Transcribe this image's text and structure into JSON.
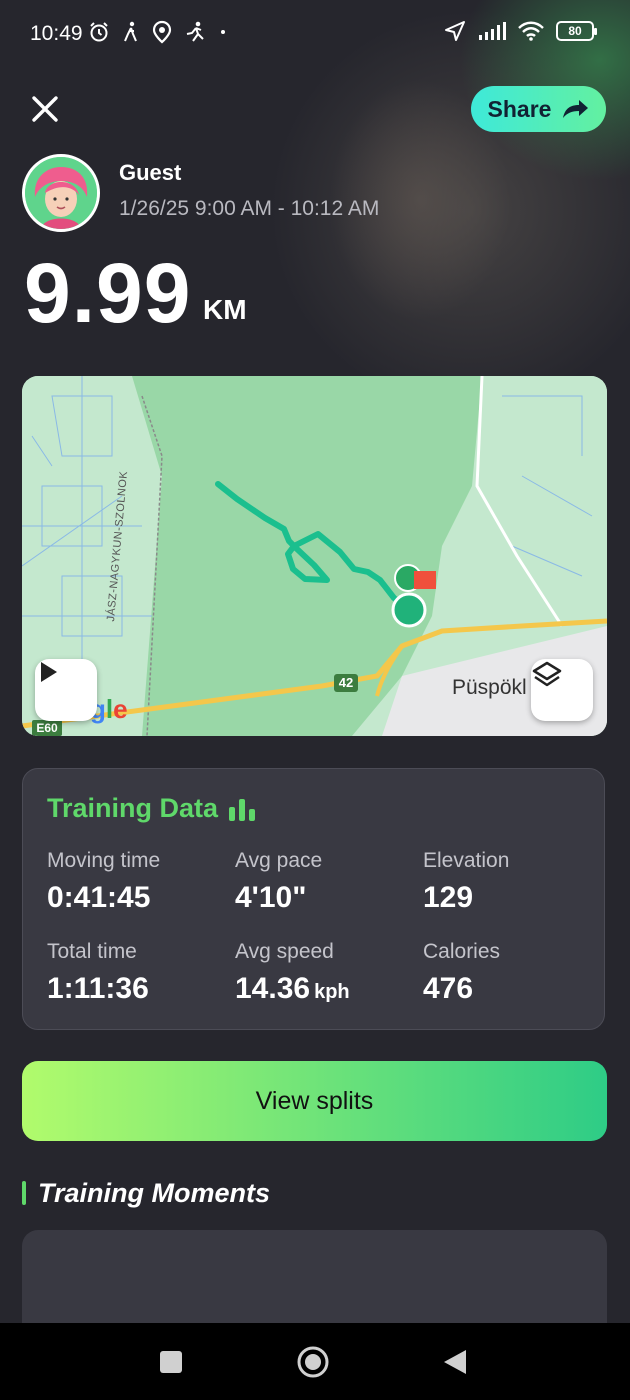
{
  "status_bar": {
    "time": "10:49",
    "battery": "80",
    "left_icons": [
      "alarm-icon",
      "walk-icon",
      "location-icon",
      "run-icon",
      "dot-icon"
    ],
    "right_icons": [
      "navigation-icon",
      "signal-icon",
      "wifi-icon",
      "battery-icon"
    ]
  },
  "header": {
    "close_icon": "close-icon",
    "share_label": "Share",
    "share_icon": "share-arrow-icon"
  },
  "user": {
    "name": "Guest",
    "date_range": "1/26/25 9:00 AM - 10:12 AM"
  },
  "distance": {
    "value": "9.99",
    "unit": "KM"
  },
  "map": {
    "town_label": "Püspökl",
    "road_number": "42",
    "euro_route": "E60",
    "road_name": "JÁSZ-NAGYKUN-SZOLNOK",
    "google_text": "Google",
    "route_color": "#1bbf8e",
    "play_icon": "play-icon",
    "layers_icon": "layers-icon"
  },
  "training": {
    "title": "Training Data",
    "title_icon": "bar-chart-icon",
    "accent_color": "#5fd86a",
    "stats": [
      {
        "label": "Moving time",
        "value": "0:41:45",
        "unit": ""
      },
      {
        "label": "Avg pace",
        "value": "4'10\"",
        "unit": ""
      },
      {
        "label": "Elevation",
        "value": "129",
        "unit": ""
      },
      {
        "label": "Total time",
        "value": "1:11:36",
        "unit": ""
      },
      {
        "label": "Avg speed",
        "value": "14.36",
        "unit": "kph"
      },
      {
        "label": "Calories",
        "value": "476",
        "unit": ""
      }
    ]
  },
  "view_splits_label": "View splits",
  "moments_title": "Training Moments",
  "nav": {
    "recents_icon": "square-icon",
    "home_icon": "circle-icon",
    "back_icon": "triangle-back-icon"
  }
}
